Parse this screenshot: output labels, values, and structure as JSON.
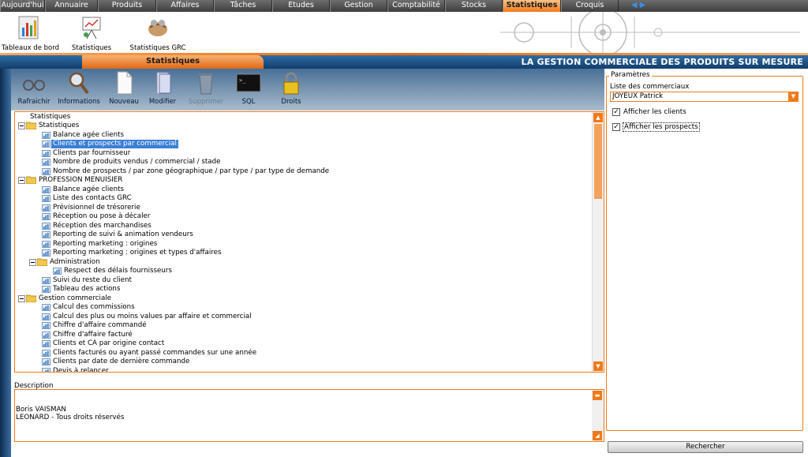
{
  "topnav": {
    "tabs": [
      {
        "label": "Aujourd'hui",
        "w": 57
      },
      {
        "label": "Annuaire",
        "w": 67
      },
      {
        "label": "Produits",
        "w": 74
      },
      {
        "label": "Affaires",
        "w": 73
      },
      {
        "label": "Tâches",
        "w": 74
      },
      {
        "label": "Etudes",
        "w": 73
      },
      {
        "label": "Gestion",
        "w": 73
      },
      {
        "label": "Comptabilité",
        "w": 73
      },
      {
        "label": "Stocks",
        "w": 73
      },
      {
        "label": "Statistiques",
        "w": 74,
        "active": true
      },
      {
        "label": "Croquis",
        "w": 73
      }
    ],
    "arrows": "◀ ▶"
  },
  "subnav": {
    "items": [
      {
        "label": "Tableaux de bord",
        "icon": "dashboard-icon"
      },
      {
        "label": "Statistiques",
        "icon": "statistics-icon"
      },
      {
        "label": "Statistiques GRC",
        "icon": "handshake-icon"
      }
    ]
  },
  "titlebar": {
    "tab_label": "Statistiques",
    "right_text": "LA GESTION COMMERCIALE DES PRODUITS SUR MESURE"
  },
  "toolbar": {
    "buttons": [
      {
        "label": "Rafraichir",
        "icon": "glasses-icon"
      },
      {
        "label": "Informations",
        "icon": "magnifier-icon"
      },
      {
        "label": "Nouveau",
        "icon": "new-document-icon"
      },
      {
        "label": "Modifier",
        "icon": "edit-document-icon"
      },
      {
        "label": "Supprimer",
        "icon": "trash-icon",
        "disabled": true
      },
      {
        "label": "SQL",
        "icon": "terminal-icon"
      },
      {
        "label": "Droits",
        "icon": "padlock-icon"
      }
    ]
  },
  "tree": {
    "root": "Statistiques",
    "nodes": [
      {
        "label": "Statistiques",
        "type": "folder",
        "level": 0
      },
      {
        "label": "Balance agée clients",
        "type": "report",
        "level": 1
      },
      {
        "label": "Clients et prospects par commercial",
        "type": "report",
        "level": 1,
        "selected": true
      },
      {
        "label": "Clients par fournisseur",
        "type": "report",
        "level": 1
      },
      {
        "label": "Nombre de produits vendus / commercial / stade",
        "type": "report",
        "level": 1
      },
      {
        "label": "Nombre de prospects / par zone géographique / par type / par type de demande",
        "type": "report",
        "level": 1
      },
      {
        "label": "PROFESSION MENUISIER",
        "type": "folder",
        "level": 0
      },
      {
        "label": "Balance agée clients",
        "type": "report",
        "level": 1
      },
      {
        "label": "Liste des contacts GRC",
        "type": "report",
        "level": 1
      },
      {
        "label": "Prévisionnel de trésorerie",
        "type": "report",
        "level": 1
      },
      {
        "label": "Réception  ou pose à décaler",
        "type": "report",
        "level": 1
      },
      {
        "label": "Réception des marchandises",
        "type": "report",
        "level": 1
      },
      {
        "label": "Reporting de suivi & animation vendeurs",
        "type": "report",
        "level": 1
      },
      {
        "label": "Reporting marketing : origines",
        "type": "report",
        "level": 1
      },
      {
        "label": "Reporting marketing : origines et types d'affaires",
        "type": "report",
        "level": 1
      },
      {
        "label": "Administration",
        "type": "folder",
        "level": 1
      },
      {
        "label": "Respect des délais fournisseurs",
        "type": "report",
        "level": 2
      },
      {
        "label": "Suivi du reste du client",
        "type": "report",
        "level": 1
      },
      {
        "label": "Tableau des actions",
        "type": "report",
        "level": 1
      },
      {
        "label": "Gestion commerciale",
        "type": "folder",
        "level": 0
      },
      {
        "label": "Calcul des commissions",
        "type": "report",
        "level": 1
      },
      {
        "label": "Calcul des plus ou moins values par affaire et commercial",
        "type": "report",
        "level": 1
      },
      {
        "label": "Chiffre d'affaire commandé",
        "type": "report",
        "level": 1
      },
      {
        "label": "Chiffre d'affaire facturé",
        "type": "report",
        "level": 1
      },
      {
        "label": "Clients et CA par origine contact",
        "type": "report",
        "level": 1
      },
      {
        "label": "Clients facturés ou ayant passé commandes sur une année",
        "type": "report",
        "level": 1
      },
      {
        "label": "Clients par date de dernière commande",
        "type": "report",
        "level": 1
      },
      {
        "label": "Devis à relancer",
        "type": "report",
        "level": 1
      }
    ]
  },
  "description": {
    "label": "Description",
    "lines": [
      "Boris VAISMAN",
      "LEONARD - Tous droits réservés"
    ]
  },
  "params": {
    "title": "Paramètres",
    "commerciaux_label": "Liste des commerciaux",
    "commerciaux_value": "JOYEUX Patrick",
    "checkboxes": [
      {
        "label": "Afficher les clients",
        "checked": true
      },
      {
        "label": "Afficher les prospects",
        "checked": true
      }
    ],
    "search_label": "Rechercher"
  },
  "colors": {
    "accent": "#f07a1a",
    "header_blue": "#1f4f82",
    "selection": "#3a7fd6"
  }
}
